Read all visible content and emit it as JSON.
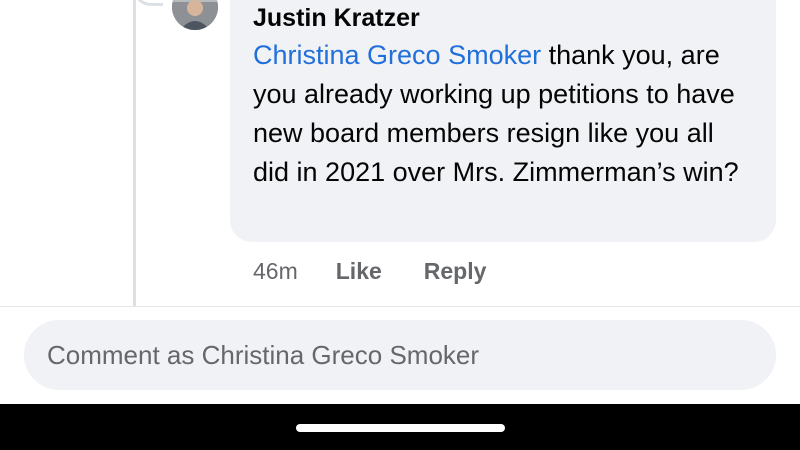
{
  "comment": {
    "author": "Justin Kratzer",
    "mention": "Christina Greco Smoker",
    "text": " thank you, are you already working up petitions to have new board members resign like you all did in 2021 over Mrs. Zimmerman’s win?",
    "time": "46m",
    "like_label": "Like",
    "reply_label": "Reply"
  },
  "composer": {
    "placeholder": "Comment as Christina Greco Smoker"
  },
  "colors": {
    "mention": "#216fdb",
    "bubble": "#f0f2f5",
    "secondary_text": "#65676b"
  }
}
